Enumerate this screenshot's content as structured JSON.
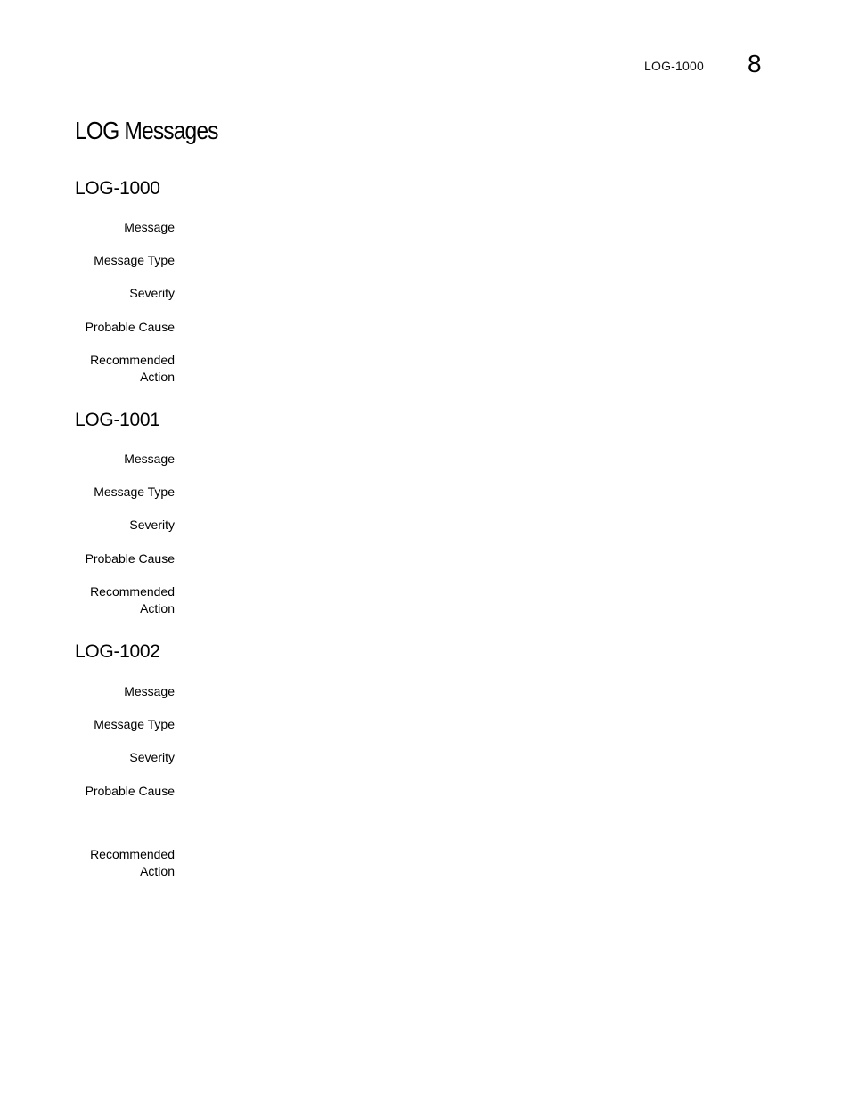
{
  "header": {
    "running_title": "LOG-1000",
    "chapter_number": "8"
  },
  "page_title": "LOG Messages",
  "sections": [
    {
      "id": "LOG-1000",
      "fields": [
        {
          "label": "Message",
          "value": ""
        },
        {
          "label": "Message Type",
          "value": ""
        },
        {
          "label": "Severity",
          "value": ""
        },
        {
          "label": "Probable Cause",
          "value": ""
        },
        {
          "label": "Recommended Action",
          "label_line1": "Recommended",
          "label_line2": "Action",
          "value": ""
        }
      ]
    },
    {
      "id": "LOG-1001",
      "fields": [
        {
          "label": "Message",
          "value": ""
        },
        {
          "label": "Message Type",
          "value": ""
        },
        {
          "label": "Severity",
          "value": ""
        },
        {
          "label": "Probable Cause",
          "value": ""
        },
        {
          "label": "Recommended Action",
          "label_line1": "Recommended",
          "label_line2": "Action",
          "value": ""
        }
      ]
    },
    {
      "id": "LOG-1002",
      "fields": [
        {
          "label": "Message",
          "value": ""
        },
        {
          "label": "Message Type",
          "value": ""
        },
        {
          "label": "Severity",
          "value": ""
        },
        {
          "label": "Probable Cause",
          "value": ""
        },
        {
          "label": "Recommended Action",
          "label_line1": "Recommended",
          "label_line2": "Action",
          "value": ""
        }
      ]
    }
  ]
}
